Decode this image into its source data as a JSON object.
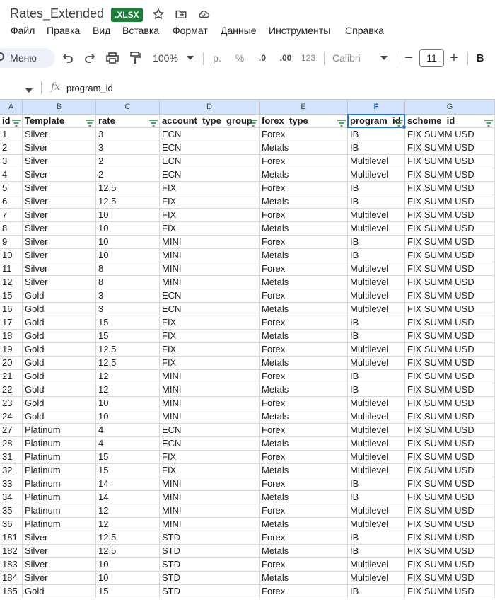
{
  "app": {
    "doc_title": "Rates_Extended",
    "badge": ".XLSX"
  },
  "menu": [
    "Файл",
    "Правка",
    "Вид",
    "Вставка",
    "Формат",
    "Данные",
    "Инструменты",
    "Справка"
  ],
  "toolbar": {
    "search_label": "Меню",
    "zoom": "100%",
    "currency": "р.",
    "percent": "%",
    "dec_decrease": ".0",
    "dec_increase": ".00",
    "number_format": "123",
    "font": "Calibri",
    "font_size": "11",
    "bold": "B"
  },
  "formula": {
    "value": "program_id"
  },
  "columns": [
    "A",
    "B",
    "C",
    "D",
    "E",
    "F",
    "G"
  ],
  "header": [
    "id",
    "Template",
    "rate",
    "account_type_group",
    "forex_type",
    "program_id",
    "scheme_id"
  ],
  "rows": [
    [
      "1",
      "Silver",
      "3",
      "ECN",
      "Forex",
      "IB",
      "FIX SUMM USD"
    ],
    [
      "2",
      "Silver",
      "3",
      "ECN",
      "Metals",
      "IB",
      "FIX SUMM USD"
    ],
    [
      "3",
      "Silver",
      "2",
      "ECN",
      "Forex",
      "Multilevel",
      "FIX SUMM USD"
    ],
    [
      "4",
      "Silver",
      "2",
      "ECN",
      "Metals",
      "Multilevel",
      "FIX SUMM USD"
    ],
    [
      "5",
      "Silver",
      "12.5",
      "FIX",
      "Forex",
      "IB",
      "FIX SUMM USD"
    ],
    [
      "6",
      "Silver",
      "12.5",
      "FIX",
      "Metals",
      "IB",
      "FIX SUMM USD"
    ],
    [
      "7",
      "Silver",
      "10",
      "FIX",
      "Forex",
      "Multilevel",
      "FIX SUMM USD"
    ],
    [
      "8",
      "Silver",
      "10",
      "FIX",
      "Metals",
      "Multilevel",
      "FIX SUMM USD"
    ],
    [
      "9",
      "Silver",
      "10",
      "MINI",
      "Forex",
      "IB",
      "FIX SUMM USD"
    ],
    [
      "10",
      "Silver",
      "10",
      "MINI",
      "Metals",
      "IB",
      "FIX SUMM USD"
    ],
    [
      "11",
      "Silver",
      "8",
      "MINI",
      "Forex",
      "Multilevel",
      "FIX SUMM USD"
    ],
    [
      "12",
      "Silver",
      "8",
      "MINI",
      "Metals",
      "Multilevel",
      "FIX SUMM USD"
    ],
    [
      "15",
      "Gold",
      "3",
      "ECN",
      "Forex",
      "Multilevel",
      "FIX SUMM USD"
    ],
    [
      "16",
      "Gold",
      "3",
      "ECN",
      "Metals",
      "Multilevel",
      "FIX SUMM USD"
    ],
    [
      "17",
      "Gold",
      "15",
      "FIX",
      "Forex",
      "IB",
      "FIX SUMM USD"
    ],
    [
      "18",
      "Gold",
      "15",
      "FIX",
      "Metals",
      "IB",
      "FIX SUMM USD"
    ],
    [
      "19",
      "Gold",
      "12.5",
      "FIX",
      "Forex",
      "Multilevel",
      "FIX SUMM USD"
    ],
    [
      "20",
      "Gold",
      "12.5",
      "FIX",
      "Metals",
      "Multilevel",
      "FIX SUMM USD"
    ],
    [
      "21",
      "Gold",
      "12",
      "MINI",
      "Forex",
      "IB",
      "FIX SUMM USD"
    ],
    [
      "22",
      "Gold",
      "12",
      "MINI",
      "Metals",
      "IB",
      "FIX SUMM USD"
    ],
    [
      "23",
      "Gold",
      "10",
      "MINI",
      "Forex",
      "Multilevel",
      "FIX SUMM USD"
    ],
    [
      "24",
      "Gold",
      "10",
      "MINI",
      "Metals",
      "Multilevel",
      "FIX SUMM USD"
    ],
    [
      "27",
      "Platinum",
      "4",
      "ECN",
      "Forex",
      "Multilevel",
      "FIX SUMM USD"
    ],
    [
      "28",
      "Platinum",
      "4",
      "ECN",
      "Metals",
      "Multilevel",
      "FIX SUMM USD"
    ],
    [
      "31",
      "Platinum",
      "15",
      "FIX",
      "Forex",
      "Multilevel",
      "FIX SUMM USD"
    ],
    [
      "32",
      "Platinum",
      "15",
      "FIX",
      "Metals",
      "Multilevel",
      "FIX SUMM USD"
    ],
    [
      "33",
      "Platinum",
      "14",
      "MINI",
      "Forex",
      "IB",
      "FIX SUMM USD"
    ],
    [
      "34",
      "Platinum",
      "14",
      "MINI",
      "Metals",
      "IB",
      "FIX SUMM USD"
    ],
    [
      "35",
      "Platinum",
      "12",
      "MINI",
      "Forex",
      "Multilevel",
      "FIX SUMM USD"
    ],
    [
      "36",
      "Platinum",
      "12",
      "MINI",
      "Metals",
      "Multilevel",
      "FIX SUMM USD"
    ],
    [
      "181",
      "Silver",
      "12.5",
      "STD",
      "Forex",
      "IB",
      "FIX SUMM USD"
    ],
    [
      "182",
      "Silver",
      "12.5",
      "STD",
      "Metals",
      "IB",
      "FIX SUMM USD"
    ],
    [
      "183",
      "Silver",
      "10",
      "STD",
      "Forex",
      "Multilevel",
      "FIX SUMM USD"
    ],
    [
      "184",
      "Silver",
      "10",
      "STD",
      "Metals",
      "Multilevel",
      "FIX SUMM USD"
    ],
    [
      "185",
      "Gold",
      "15",
      "STD",
      "Forex",
      "IB",
      "FIX SUMM USD"
    ]
  ],
  "colors": {
    "badge": "#188038",
    "selection": "#1a73e8",
    "header_active": "#d3e3fd"
  }
}
